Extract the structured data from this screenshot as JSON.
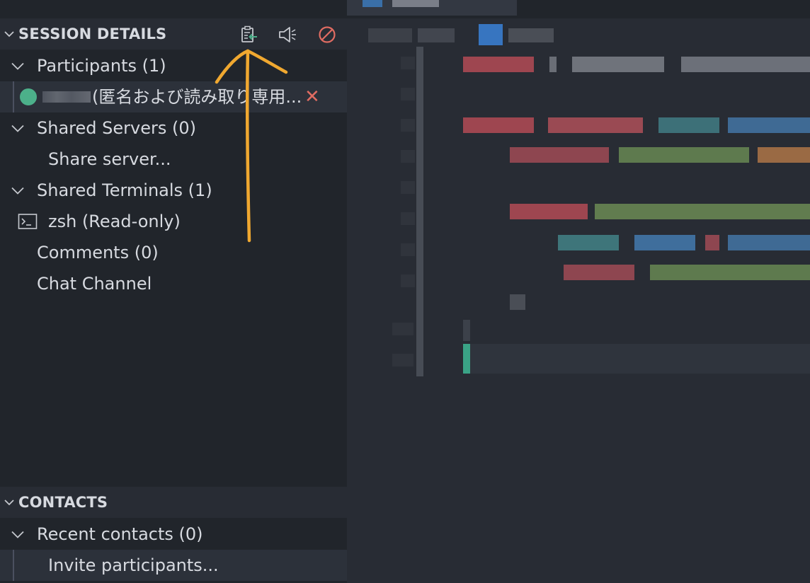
{
  "session": {
    "title": "SESSION DETAILS",
    "actions": {
      "copy_link_icon": "clipboard-arrow-icon",
      "focus_icon": "megaphone-icon",
      "end_icon": "stop-circle-icon"
    },
    "participants": {
      "label": "Participants (1)",
      "items": [
        {
          "name_suffix": "(匿名および読み取り専用...",
          "status_color": "#4cb08a"
        }
      ]
    },
    "shared_servers": {
      "label": "Shared Servers (0)",
      "action": "Share server..."
    },
    "shared_terminals": {
      "label": "Shared Terminals (1)",
      "items": [
        {
          "label": "zsh (Read-only)"
        }
      ]
    },
    "comments": {
      "label": "Comments (0)"
    },
    "chat": {
      "label": "Chat Channel"
    }
  },
  "contacts": {
    "title": "CONTACTS",
    "recent": {
      "label": "Recent contacts (0)"
    },
    "invite": {
      "label": "Invite participants..."
    }
  },
  "colors": {
    "accent_arrow": "#f0a830",
    "remove": "#e06c62",
    "stop": "#e06c62",
    "online": "#4cb08a"
  }
}
